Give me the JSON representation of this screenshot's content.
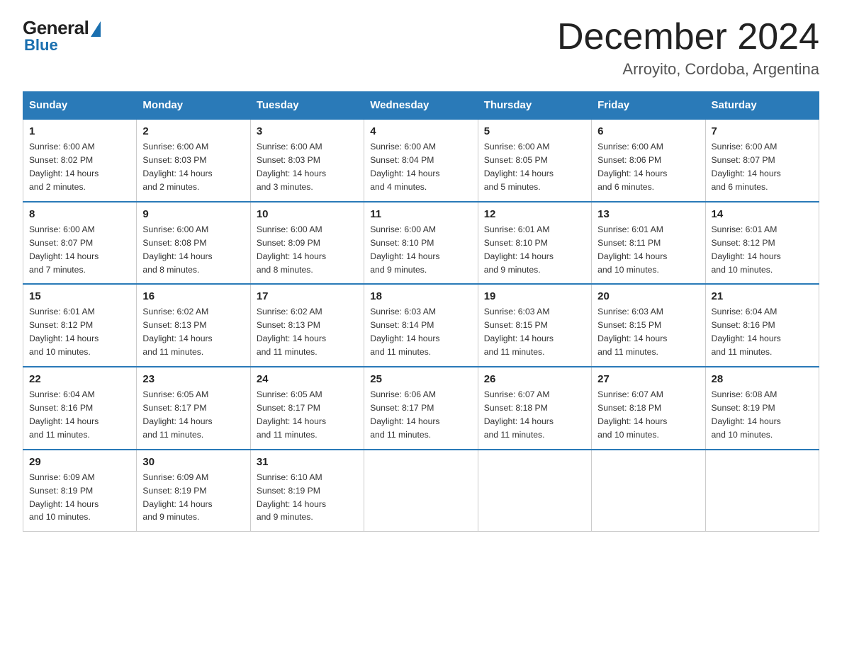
{
  "header": {
    "logo_general": "General",
    "logo_blue": "Blue",
    "month_title": "December 2024",
    "location": "Arroyito, Cordoba, Argentina"
  },
  "days_of_week": [
    "Sunday",
    "Monday",
    "Tuesday",
    "Wednesday",
    "Thursday",
    "Friday",
    "Saturday"
  ],
  "weeks": [
    [
      {
        "day": "1",
        "sunrise": "6:00 AM",
        "sunset": "8:02 PM",
        "daylight": "14 hours and 2 minutes."
      },
      {
        "day": "2",
        "sunrise": "6:00 AM",
        "sunset": "8:03 PM",
        "daylight": "14 hours and 2 minutes."
      },
      {
        "day": "3",
        "sunrise": "6:00 AM",
        "sunset": "8:03 PM",
        "daylight": "14 hours and 3 minutes."
      },
      {
        "day": "4",
        "sunrise": "6:00 AM",
        "sunset": "8:04 PM",
        "daylight": "14 hours and 4 minutes."
      },
      {
        "day": "5",
        "sunrise": "6:00 AM",
        "sunset": "8:05 PM",
        "daylight": "14 hours and 5 minutes."
      },
      {
        "day": "6",
        "sunrise": "6:00 AM",
        "sunset": "8:06 PM",
        "daylight": "14 hours and 6 minutes."
      },
      {
        "day": "7",
        "sunrise": "6:00 AM",
        "sunset": "8:07 PM",
        "daylight": "14 hours and 6 minutes."
      }
    ],
    [
      {
        "day": "8",
        "sunrise": "6:00 AM",
        "sunset": "8:07 PM",
        "daylight": "14 hours and 7 minutes."
      },
      {
        "day": "9",
        "sunrise": "6:00 AM",
        "sunset": "8:08 PM",
        "daylight": "14 hours and 8 minutes."
      },
      {
        "day": "10",
        "sunrise": "6:00 AM",
        "sunset": "8:09 PM",
        "daylight": "14 hours and 8 minutes."
      },
      {
        "day": "11",
        "sunrise": "6:00 AM",
        "sunset": "8:10 PM",
        "daylight": "14 hours and 9 minutes."
      },
      {
        "day": "12",
        "sunrise": "6:01 AM",
        "sunset": "8:10 PM",
        "daylight": "14 hours and 9 minutes."
      },
      {
        "day": "13",
        "sunrise": "6:01 AM",
        "sunset": "8:11 PM",
        "daylight": "14 hours and 10 minutes."
      },
      {
        "day": "14",
        "sunrise": "6:01 AM",
        "sunset": "8:12 PM",
        "daylight": "14 hours and 10 minutes."
      }
    ],
    [
      {
        "day": "15",
        "sunrise": "6:01 AM",
        "sunset": "8:12 PM",
        "daylight": "14 hours and 10 minutes."
      },
      {
        "day": "16",
        "sunrise": "6:02 AM",
        "sunset": "8:13 PM",
        "daylight": "14 hours and 11 minutes."
      },
      {
        "day": "17",
        "sunrise": "6:02 AM",
        "sunset": "8:13 PM",
        "daylight": "14 hours and 11 minutes."
      },
      {
        "day": "18",
        "sunrise": "6:03 AM",
        "sunset": "8:14 PM",
        "daylight": "14 hours and 11 minutes."
      },
      {
        "day": "19",
        "sunrise": "6:03 AM",
        "sunset": "8:15 PM",
        "daylight": "14 hours and 11 minutes."
      },
      {
        "day": "20",
        "sunrise": "6:03 AM",
        "sunset": "8:15 PM",
        "daylight": "14 hours and 11 minutes."
      },
      {
        "day": "21",
        "sunrise": "6:04 AM",
        "sunset": "8:16 PM",
        "daylight": "14 hours and 11 minutes."
      }
    ],
    [
      {
        "day": "22",
        "sunrise": "6:04 AM",
        "sunset": "8:16 PM",
        "daylight": "14 hours and 11 minutes."
      },
      {
        "day": "23",
        "sunrise": "6:05 AM",
        "sunset": "8:17 PM",
        "daylight": "14 hours and 11 minutes."
      },
      {
        "day": "24",
        "sunrise": "6:05 AM",
        "sunset": "8:17 PM",
        "daylight": "14 hours and 11 minutes."
      },
      {
        "day": "25",
        "sunrise": "6:06 AM",
        "sunset": "8:17 PM",
        "daylight": "14 hours and 11 minutes."
      },
      {
        "day": "26",
        "sunrise": "6:07 AM",
        "sunset": "8:18 PM",
        "daylight": "14 hours and 11 minutes."
      },
      {
        "day": "27",
        "sunrise": "6:07 AM",
        "sunset": "8:18 PM",
        "daylight": "14 hours and 10 minutes."
      },
      {
        "day": "28",
        "sunrise": "6:08 AM",
        "sunset": "8:19 PM",
        "daylight": "14 hours and 10 minutes."
      }
    ],
    [
      {
        "day": "29",
        "sunrise": "6:09 AM",
        "sunset": "8:19 PM",
        "daylight": "14 hours and 10 minutes."
      },
      {
        "day": "30",
        "sunrise": "6:09 AM",
        "sunset": "8:19 PM",
        "daylight": "14 hours and 9 minutes."
      },
      {
        "day": "31",
        "sunrise": "6:10 AM",
        "sunset": "8:19 PM",
        "daylight": "14 hours and 9 minutes."
      },
      null,
      null,
      null,
      null
    ]
  ],
  "labels": {
    "sunrise": "Sunrise:",
    "sunset": "Sunset:",
    "daylight": "Daylight:"
  }
}
